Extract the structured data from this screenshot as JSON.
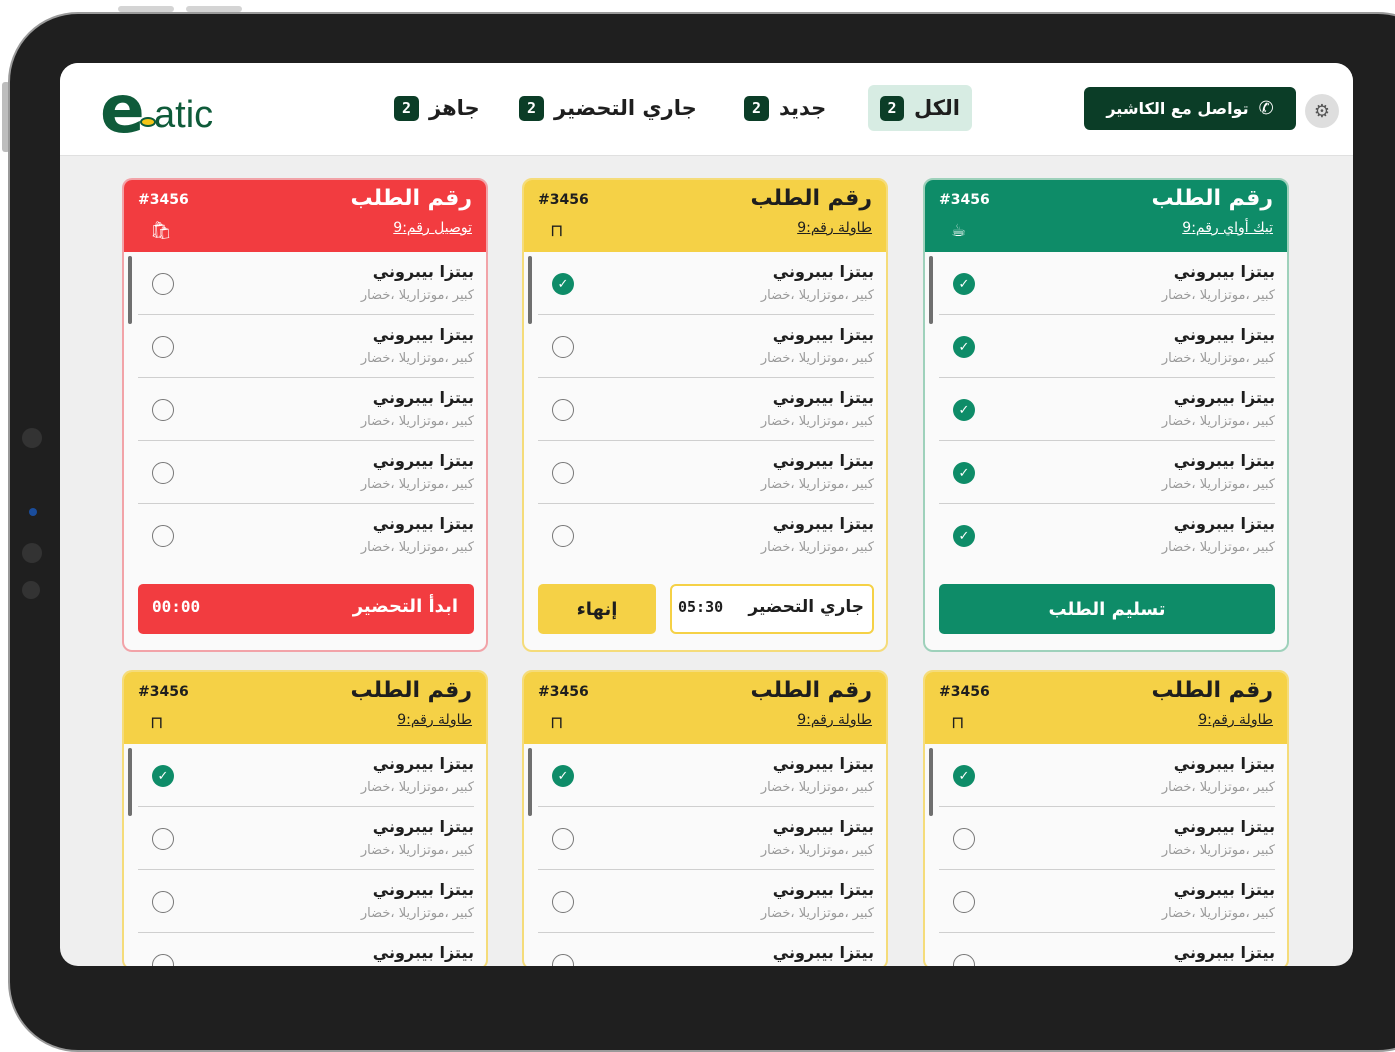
{
  "app": {
    "logo_mark": "e",
    "logo_text": "atic"
  },
  "header": {
    "tabs": [
      {
        "label": "الكل",
        "count": "2",
        "active": true
      },
      {
        "label": "جديد",
        "count": "2",
        "active": false
      },
      {
        "label": "جاري التحضير",
        "count": "2",
        "active": false
      },
      {
        "label": "جاهز",
        "count": "2",
        "active": false
      }
    ],
    "cashier_button": "تواصل مع الكاشير",
    "settings_icon": "gear-icon",
    "phone_icon": "phone-icon"
  },
  "colors": {
    "brand_dark": "#0b3d27",
    "red": "#f23c40",
    "yellow": "#f5d146",
    "green": "#0e8c68"
  },
  "cards": [
    {
      "color": "red",
      "title": "رقم الطلب",
      "number": "#3456",
      "type": "توصيل رقم:9",
      "type_icon": "bag-icon",
      "items": [
        {
          "name": "بيتزا بيبروني",
          "desc": "كبير ،موتزاريلا ،خضار",
          "checked": false
        },
        {
          "name": "بيتزا بيبروني",
          "desc": "كبير ،موتزاريلا ،خضار",
          "checked": false
        },
        {
          "name": "بيتزا بيبروني",
          "desc": "كبير ،موتزاريلا ،خضار",
          "checked": false
        },
        {
          "name": "بيتزا بيبروني",
          "desc": "كبير ،موتزاريلا ،خضار",
          "checked": false
        },
        {
          "name": "بيتزا بيبروني",
          "desc": "كبير ،موتزاريلا ،خضار",
          "checked": false
        }
      ],
      "action": {
        "label": "ابدأ التحضير",
        "time": "00:00"
      }
    },
    {
      "color": "yellow",
      "title": "رقم الطلب",
      "number": "#3456",
      "type": "طاولة رقم:9",
      "type_icon": "table-icon",
      "items": [
        {
          "name": "بيتزا بيبروني",
          "desc": "كبير ،موتزاريلا ،خضار",
          "checked": true
        },
        {
          "name": "بيتزا بيبروني",
          "desc": "كبير ،موتزاريلا ،خضار",
          "checked": false
        },
        {
          "name": "بيتزا بيبروني",
          "desc": "كبير ،موتزاريلا ،خضار",
          "checked": false
        },
        {
          "name": "بيتزا بيبروني",
          "desc": "كبير ،موتزاريلا ،خضار",
          "checked": false
        },
        {
          "name": "بيتزا بيبروني",
          "desc": "كبير ،موتزاريلا ،خضار",
          "checked": false
        }
      ],
      "action": {
        "finish": "إنهاء",
        "status": "جاري التحضير",
        "time": "05:30"
      }
    },
    {
      "color": "green",
      "title": "رقم الطلب",
      "number": "#3456",
      "type": "تيك أواي رقم:9",
      "type_icon": "takeaway-cup-icon",
      "items": [
        {
          "name": "بيتزا بيبروني",
          "desc": "كبير ،موتزاريلا ،خضار",
          "checked": true
        },
        {
          "name": "بيتزا بيبروني",
          "desc": "كبير ،موتزاريلا ،خضار",
          "checked": true
        },
        {
          "name": "بيتزا بيبروني",
          "desc": "كبير ،موتزاريلا ،خضار",
          "checked": true
        },
        {
          "name": "بيتزا بيبروني",
          "desc": "كبير ،موتزاريلا ،خضار",
          "checked": true
        },
        {
          "name": "بيتزا بيبروني",
          "desc": "كبير ،موتزاريلا ،خضار",
          "checked": true
        }
      ],
      "action": {
        "label": "تسليم الطلب"
      }
    },
    {
      "color": "yellow",
      "title": "رقم الطلب",
      "number": "#3456",
      "type": "طاولة رقم:9",
      "type_icon": "table-icon",
      "items": [
        {
          "name": "بيتزا بيبروني",
          "desc": "كبير ،موتزاريلا ،خضار",
          "checked": true
        },
        {
          "name": "بيتزا بيبروني",
          "desc": "كبير ،موتزاريلا ،خضار",
          "checked": false
        },
        {
          "name": "بيتزا بيبروني",
          "desc": "كبير ،موتزاريلا ،خضار",
          "checked": false
        },
        {
          "name": "بيتزا بيبروني",
          "desc": "",
          "checked": false
        }
      ]
    },
    {
      "color": "yellow",
      "title": "رقم الطلب",
      "number": "#3456",
      "type": "طاولة رقم:9",
      "type_icon": "table-icon",
      "items": [
        {
          "name": "بيتزا بيبروني",
          "desc": "كبير ،موتزاريلا ،خضار",
          "checked": true
        },
        {
          "name": "بيتزا بيبروني",
          "desc": "كبير ،موتزاريلا ،خضار",
          "checked": false
        },
        {
          "name": "بيتزا بيبروني",
          "desc": "كبير ،موتزاريلا ،خضار",
          "checked": false
        },
        {
          "name": "بيتزا بيبروني",
          "desc": "",
          "checked": false
        }
      ]
    },
    {
      "color": "yellow",
      "title": "رقم الطلب",
      "number": "#3456",
      "type": "طاولة رقم:9",
      "type_icon": "table-icon",
      "items": [
        {
          "name": "بيتزا بيبروني",
          "desc": "كبير ،موتزاريلا ،خضار",
          "checked": true
        },
        {
          "name": "بيتزا بيبروني",
          "desc": "كبير ،موتزاريلا ،خضار",
          "checked": false
        },
        {
          "name": "بيتزا بيبروني",
          "desc": "كبير ،موتزاريلا ،خضار",
          "checked": false
        },
        {
          "name": "بيتزا بيبروني",
          "desc": "",
          "checked": false
        }
      ]
    }
  ]
}
